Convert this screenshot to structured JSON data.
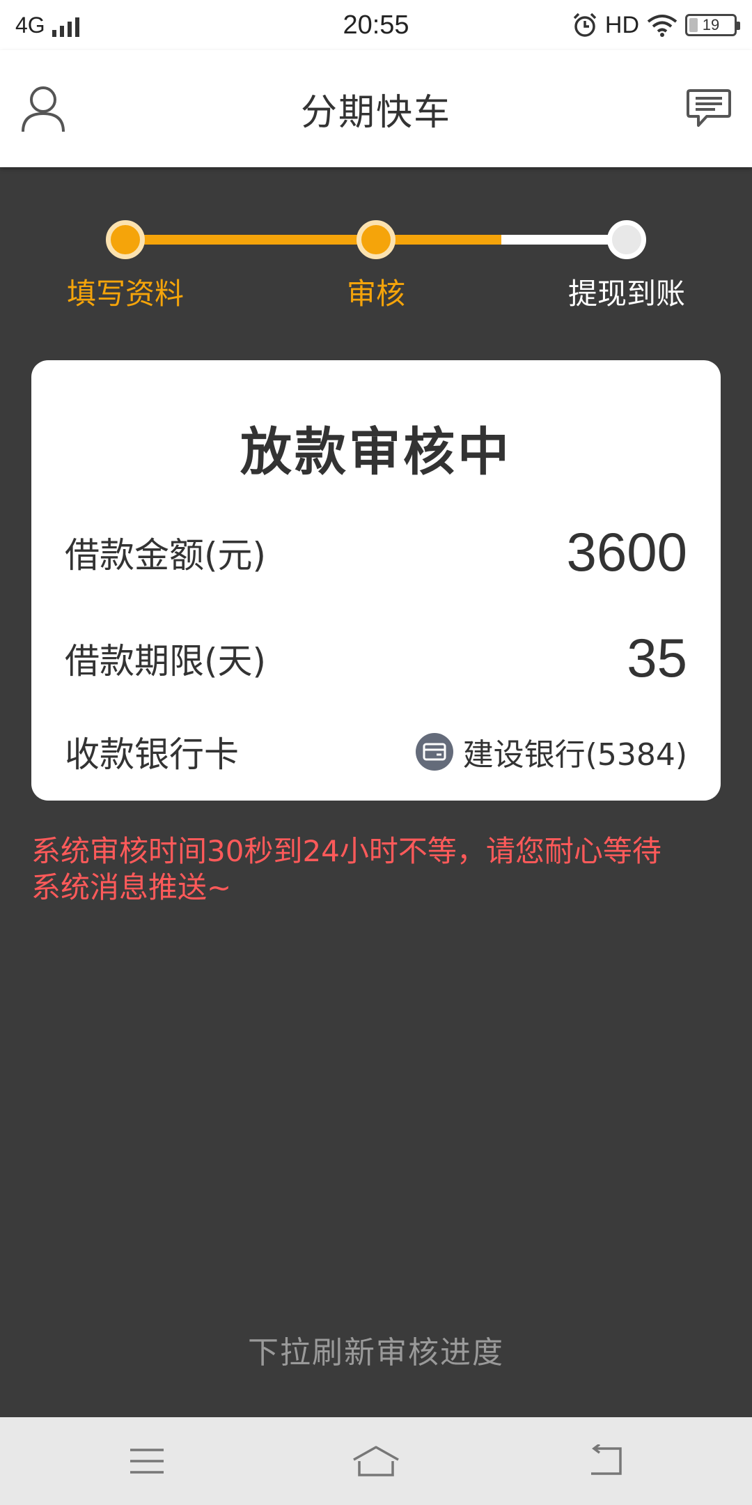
{
  "status_bar": {
    "network": "4G",
    "time": "20:55",
    "hd_label": "HD",
    "battery": "19"
  },
  "header": {
    "title": "分期快车",
    "left_icon": "user-icon",
    "right_icon": "message-icon"
  },
  "stepper": {
    "steps": [
      {
        "label": "填写资料",
        "state": "done"
      },
      {
        "label": "审核",
        "state": "current"
      },
      {
        "label": "提现到账",
        "state": "pending"
      }
    ],
    "active_color": "#f5a40a"
  },
  "card": {
    "title": "放款审核中",
    "amount_label": "借款金额(元)",
    "amount_value": "3600",
    "term_label": "借款期限(天)",
    "term_value": "35",
    "bank_label": "收款银行卡",
    "bank_value": "建设银行(5384)",
    "bank_icon": "bank-card-icon"
  },
  "notice": {
    "line1": "系统审核时间30秒到24小时不等，请您耐心等待",
    "line2": "系统消息推送~",
    "color": "#ff5a5a"
  },
  "pull_hint": "下拉刷新审核进度",
  "navbar": {
    "items": [
      "menu-icon",
      "home-icon",
      "back-icon"
    ]
  }
}
